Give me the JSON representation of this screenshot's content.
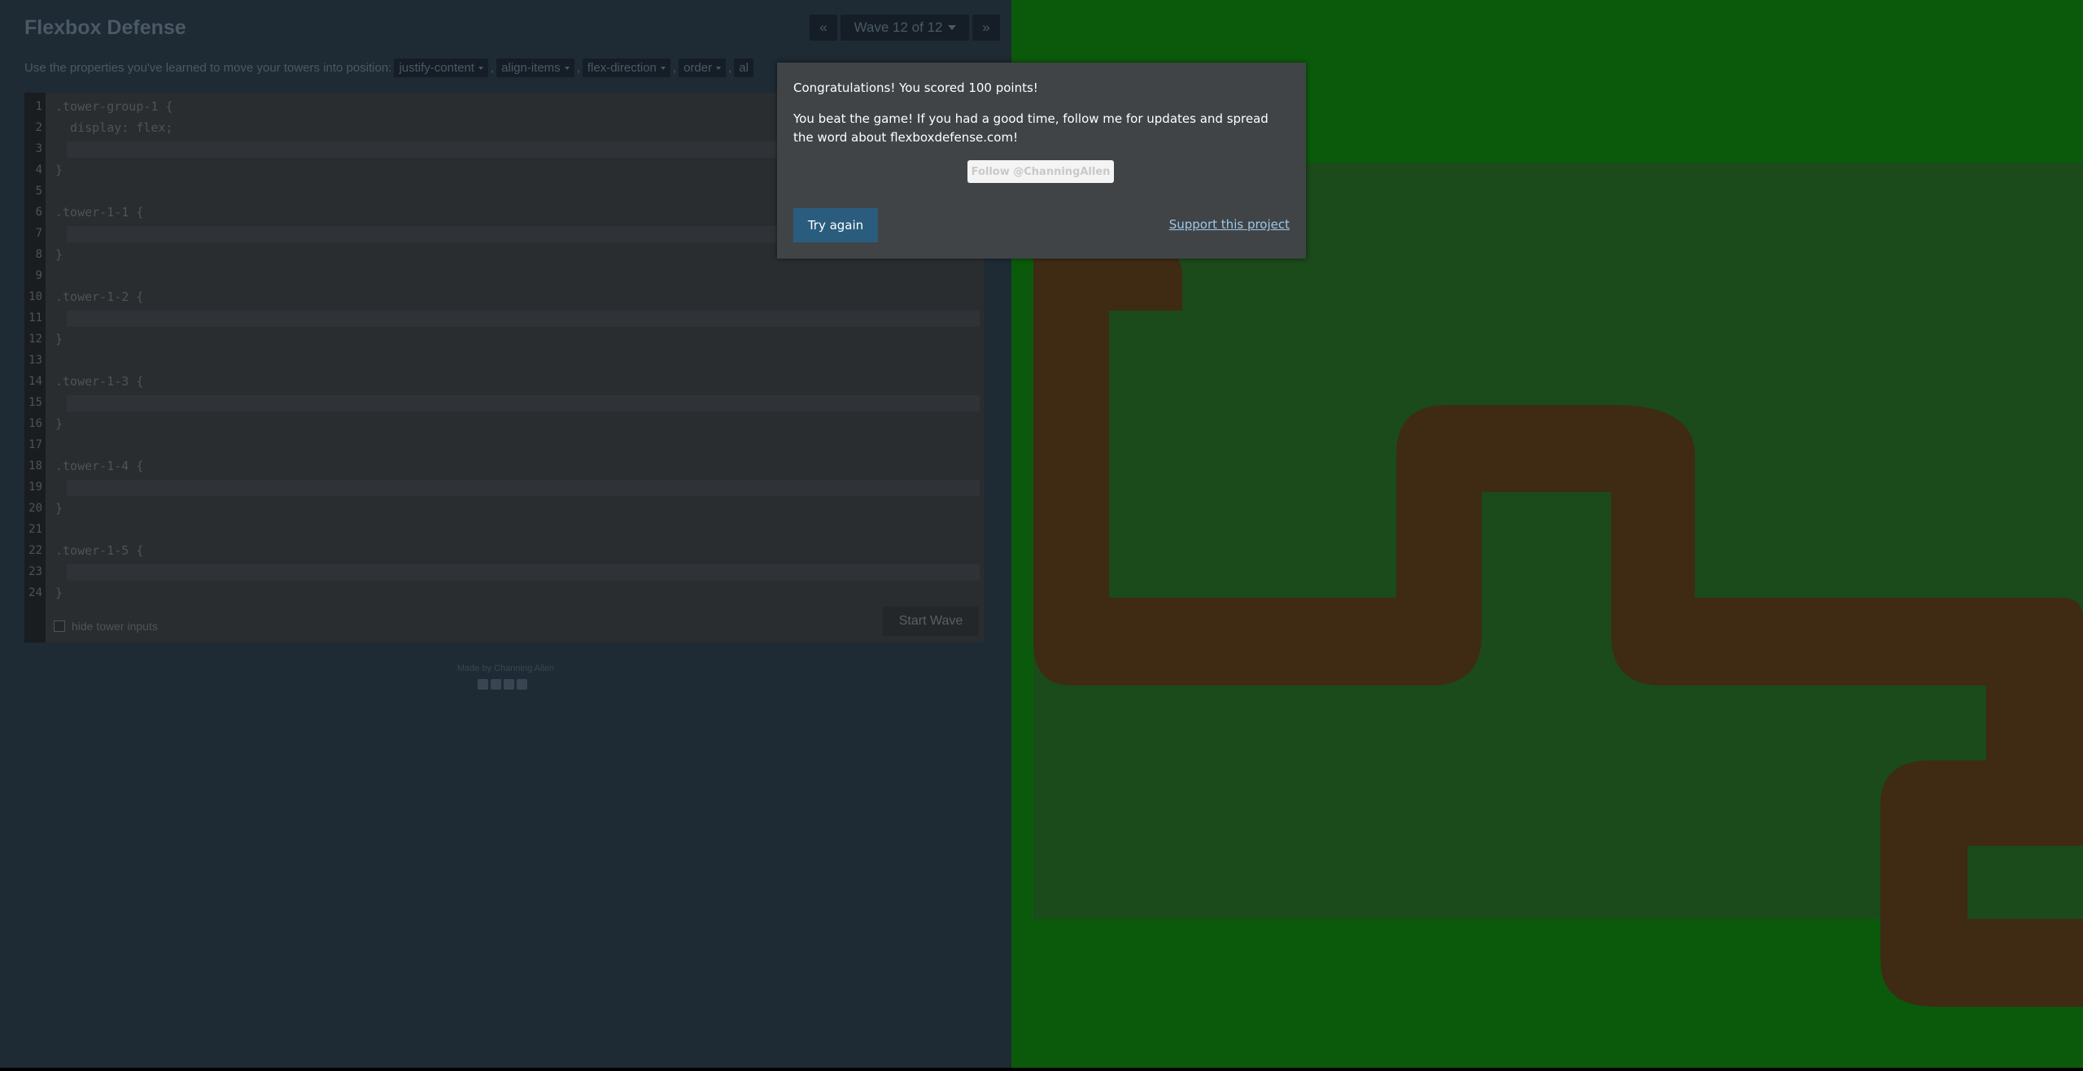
{
  "header": {
    "title": "Flexbox Defense",
    "prev_icon": "«",
    "next_icon": "»",
    "wave_label": "Wave 12 of 12"
  },
  "instructions": {
    "text": "Use the properties you've learned to move your towers into position:",
    "properties": [
      "justify-content",
      "align-items",
      "flex-direction",
      "order",
      "al"
    ]
  },
  "editor": {
    "lines": [
      {
        "num": "1",
        "code": ".tower-group-1 {"
      },
      {
        "num": "2",
        "code": "  display: flex;"
      },
      {
        "num": "3",
        "code": "",
        "input": true
      },
      {
        "num": "4",
        "code": "}"
      },
      {
        "num": "5",
        "code": ""
      },
      {
        "num": "6",
        "code": ".tower-1-1 {"
      },
      {
        "num": "7",
        "code": "",
        "input": true
      },
      {
        "num": "8",
        "code": "}"
      },
      {
        "num": "9",
        "code": ""
      },
      {
        "num": "10",
        "code": ".tower-1-2 {"
      },
      {
        "num": "11",
        "code": "",
        "input": true
      },
      {
        "num": "12",
        "code": "}"
      },
      {
        "num": "13",
        "code": ""
      },
      {
        "num": "14",
        "code": ".tower-1-3 {"
      },
      {
        "num": "15",
        "code": "",
        "input": true
      },
      {
        "num": "16",
        "code": "}"
      },
      {
        "num": "17",
        "code": ""
      },
      {
        "num": "18",
        "code": ".tower-1-4 {"
      },
      {
        "num": "19",
        "code": "",
        "input": true
      },
      {
        "num": "20",
        "code": "}"
      },
      {
        "num": "21",
        "code": ""
      },
      {
        "num": "22",
        "code": ".tower-1-5 {"
      },
      {
        "num": "23",
        "code": "",
        "input": true
      },
      {
        "num": "24",
        "code": "}"
      }
    ],
    "hide_inputs_label": "hide tower inputs",
    "start_wave_label": "Start Wave"
  },
  "footer": {
    "credit": "Made by Channing Allen"
  },
  "modal": {
    "congrats": "Congratulations! You scored 100 points!",
    "beat": "You beat the game! If you had a good time, follow me for updates and spread the word about flexboxdefense.com!",
    "follow_label": "Follow @ChanningAllen",
    "try_again_label": "Try again",
    "support_label": "Support this project"
  },
  "colors": {
    "path": "#3f2a14",
    "grass": "#0b5a0b",
    "accent": "#2a5c7e"
  }
}
